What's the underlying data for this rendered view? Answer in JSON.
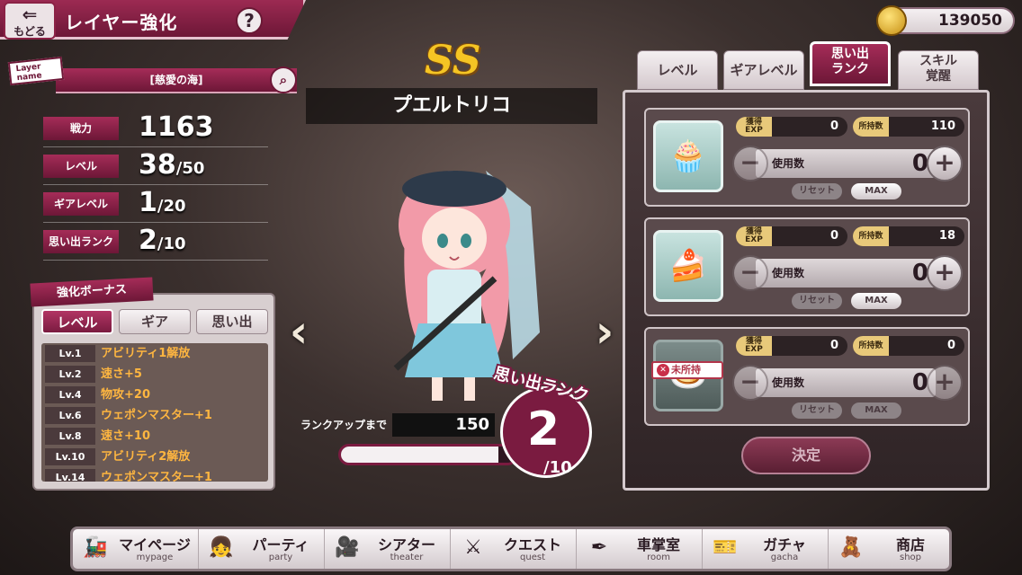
{
  "header": {
    "back_label": "もどる",
    "title": "レイヤー強化",
    "help_icon": "?"
  },
  "currency": {
    "amount": "139050"
  },
  "layer": {
    "tag": "Layer name",
    "name": "[慈愛の海]"
  },
  "stats": [
    {
      "label": "戦力",
      "value": "1163",
      "max": ""
    },
    {
      "label": "レベル",
      "value": "38",
      "max": "/50"
    },
    {
      "label": "ギアレベル",
      "value": "1",
      "max": "/20"
    },
    {
      "label": "思い出ランク",
      "value": "2",
      "max": "/10"
    }
  ],
  "bonus": {
    "title": "強化ボーナス",
    "tabs": [
      "レベル",
      "ギア",
      "思い出"
    ],
    "active_tab": 0,
    "items": [
      {
        "lv": "Lv.1",
        "text": "アビリティ1解放"
      },
      {
        "lv": "Lv.2",
        "text": "速さ+5"
      },
      {
        "lv": "Lv.4",
        "text": "物攻+20"
      },
      {
        "lv": "Lv.6",
        "text": "ウェポンマスター+1"
      },
      {
        "lv": "Lv.8",
        "text": "速さ+10"
      },
      {
        "lv": "Lv.10",
        "text": "アビリティ2解放"
      },
      {
        "lv": "Lv.14",
        "text": "ウェポンマスター+1"
      }
    ]
  },
  "character": {
    "rank_badge": "SS",
    "name": "プエルトリコ",
    "rankup_label": "ランクアップまで",
    "rankup_value": "150",
    "progress": 0.9,
    "rank_title": "思い出ランク",
    "rank_current": "2",
    "rank_max": "/10"
  },
  "right_tabs": [
    {
      "label": "レベル",
      "active": false
    },
    {
      "label": "ギアレベル",
      "active": false
    },
    {
      "label": "思い出\nランク",
      "active": true
    },
    {
      "label": "スキル\n覚醒",
      "active": false
    }
  ],
  "items_panel": {
    "exp_label": "獲得\nEXP",
    "owned_label": "所持数",
    "use_label": "使用数",
    "reset_label": "リセット",
    "max_label": "MAX",
    "unowned_label": "未所持",
    "items": [
      {
        "icon": "cupcake-icon",
        "exp": "0",
        "owned": "110",
        "use": "0",
        "unowned": false
      },
      {
        "icon": "cake-icon",
        "exp": "0",
        "owned": "18",
        "use": "0",
        "unowned": false
      },
      {
        "icon": "cake-dish-icon",
        "exp": "0",
        "owned": "0",
        "use": "0",
        "unowned": true
      }
    ],
    "decide_label": "決定"
  },
  "bottom_nav": [
    {
      "label": "マイページ",
      "sub": "mypage",
      "icon": "train-icon"
    },
    {
      "label": "パーティ",
      "sub": "party",
      "icon": "character-icon"
    },
    {
      "label": "シアター",
      "sub": "theater",
      "icon": "projector-icon"
    },
    {
      "label": "クエスト",
      "sub": "quest",
      "icon": "swords-icon"
    },
    {
      "label": "車掌室",
      "sub": "room",
      "icon": "pen-icon"
    },
    {
      "label": "ガチャ",
      "sub": "gacha",
      "icon": "ticket-icon"
    },
    {
      "label": "商店",
      "sub": "shop",
      "icon": "shopkeeper-icon"
    }
  ],
  "colors": {
    "accent": "#8b2246",
    "gold": "#f5c524",
    "bonus_text": "#ffb640"
  }
}
